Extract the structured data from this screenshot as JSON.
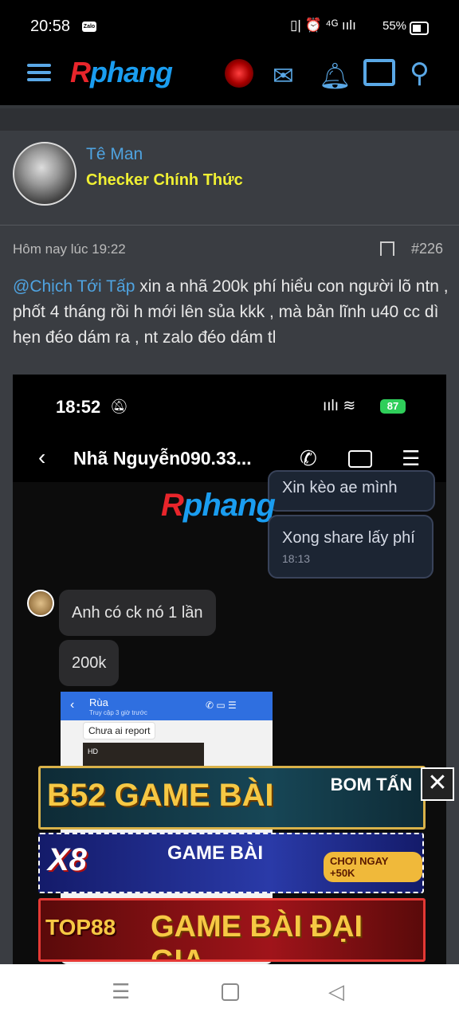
{
  "status": {
    "time": "20:58",
    "zalo": "Zalo",
    "icons": "▯| ⏰ ⁴ᴳ ıılı",
    "battery": "55%"
  },
  "nav": {
    "logo_r": "R",
    "logo_rest": "phang"
  },
  "post": {
    "author": "Tê Man",
    "role": "Checker Chính Thức",
    "date": "Hôm nay lúc 19:22",
    "number": "#226",
    "mention": "@Chịch Tới Tấp",
    "text": " xin a nhã 200k phí hiểu con người lõ ntn , phốt 4 tháng rồi h mới lên sủa kkk , mà bản lĩnh u40 cc dì hẹn đéo dám ra , nt zalo đéo dám tl"
  },
  "shot": {
    "time": "18:52",
    "battery": "87",
    "contact": "Nhã Nguyễn090.33...",
    "msg_cut": "Xin kèo ae mình",
    "msg_share": "Xong share lấy phí",
    "msg_share_time": "18:13",
    "msg_ck": "Anh có ck nó 1 lần",
    "msg_200k": "200k",
    "mini_title": "Rùa",
    "mini_sub": "Truy cập 3 giờ trước",
    "mini_msg": "Chưa ai report",
    "mini_hd": "HD"
  },
  "ads": [
    {
      "main": "B52 GAME BÀI",
      "side": "BOM TẤN"
    },
    {
      "main": "GAME BÀI",
      "logo": "X8",
      "side": "CHƠI NGAY +50K"
    },
    {
      "main": "GAME BÀI ĐẠI GIA",
      "logo": "TOP88"
    }
  ],
  "close": "✕"
}
